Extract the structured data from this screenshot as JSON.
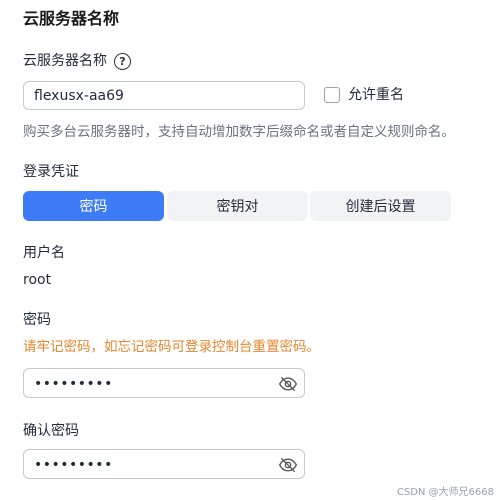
{
  "section": {
    "title": "云服务器名称"
  },
  "name_field": {
    "label": "云服务器名称",
    "help_glyph": "?",
    "value": "flexusx-aa69",
    "allow_duplicate_label": "允许重名",
    "allow_duplicate_checked": false,
    "hint": "购买多台云服务器时，支持自动增加数字后缀命名或者自定义规则命名。"
  },
  "credentials": {
    "label": "登录凭证",
    "options": [
      {
        "label": "密码",
        "active": true
      },
      {
        "label": "密钥对",
        "active": false
      },
      {
        "label": "创建后设置",
        "active": false
      }
    ]
  },
  "username": {
    "label": "用户名",
    "value": "root"
  },
  "password": {
    "label": "密码",
    "warning": "请牢记密码，如忘记密码可登录控制台重置密码。",
    "masked_value": "•••••••••"
  },
  "confirm_password": {
    "label": "确认密码",
    "masked_value": "•••••••••"
  },
  "watermark": "CSDN @大师兄6668",
  "colors": {
    "accent": "#3e7bf7",
    "warning": "#e6862e",
    "hint": "#6b717d",
    "border": "#c6c9d0"
  },
  "icons": {
    "help": "question-circle-icon",
    "password_visibility": "eye-slash-icon"
  }
}
